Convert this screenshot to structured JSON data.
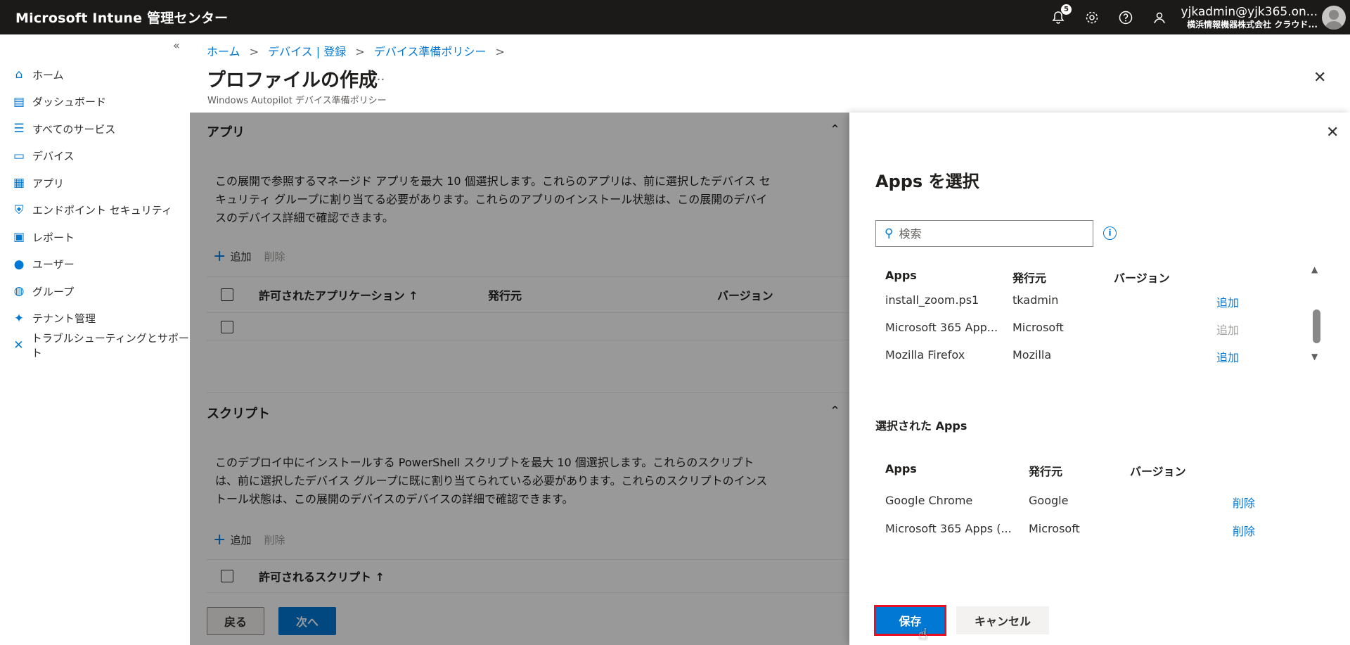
{
  "topbar": {
    "brand": "Microsoft Intune 管理センター",
    "notification_count": "5",
    "icons": [
      "bell-icon",
      "gear-icon",
      "help-icon",
      "feedback-icon"
    ],
    "account_name": "yjkadmin@yjk365.on...",
    "account_org": "横浜情報機器株式会社 クラウド..."
  },
  "sidebar": {
    "collapse_glyph": "«",
    "items": [
      {
        "label": "ホーム",
        "icon": "home-icon",
        "glyph": "⌂"
      },
      {
        "label": "ダッシュボード",
        "icon": "dashboard-icon",
        "glyph": "▤"
      },
      {
        "label": "すべてのサービス",
        "icon": "list-icon",
        "glyph": "☰"
      },
      {
        "label": "デバイス",
        "icon": "device-icon",
        "glyph": "▭"
      },
      {
        "label": "アプリ",
        "icon": "apps-grid-icon",
        "glyph": "▦"
      },
      {
        "label": "エンドポイント セキュリティ",
        "icon": "shield-icon",
        "glyph": "⛨"
      },
      {
        "label": "レポート",
        "icon": "report-icon",
        "glyph": "▣"
      },
      {
        "label": "ユーザー",
        "icon": "user-icon",
        "glyph": "●"
      },
      {
        "label": "グループ",
        "icon": "group-icon",
        "glyph": "◍"
      },
      {
        "label": "テナント管理",
        "icon": "tenant-icon",
        "glyph": "✦"
      },
      {
        "label": "トラブルシューティングとサポート",
        "icon": "wrench-icon",
        "glyph": "✕"
      }
    ]
  },
  "breadcrumb": {
    "items": [
      "ホーム",
      "デバイス | 登録",
      "デバイス準備ポリシー"
    ],
    "sep": ">"
  },
  "page": {
    "title": "プロファイルの作成",
    "more": "...",
    "subtitle": "Windows Autopilot デバイス準備ポリシー",
    "close": "✕"
  },
  "apps_section": {
    "title": "アプリ",
    "description": "この展開で参照するマネージド アプリを最大 10 個選択します。これらのアプリは、前に選択したデバイス セキュリティ グループに割り当てる必要があります。これらのアプリのインストール状態は、この展開のデバイスのデバイス詳細で確認できます。",
    "add": "追加",
    "delete": "削除",
    "columns": [
      "許可されたアプリケーション ↑",
      "発行元",
      "バージョン"
    ]
  },
  "scripts_section": {
    "title": "スクリプト",
    "description": "このデプロイ中にインストールする PowerShell スクリプトを最大 10 個選択します。これらのスクリプトは、前に選択したデバイス グループに既に割り当てられている必要があります。これらのスクリプトのインストール状態は、この展開のデバイスのデバイスの詳細で確認できます。",
    "add": "追加",
    "delete": "削除",
    "columns": [
      "許可されるスクリプト ↑"
    ]
  },
  "footer": {
    "back": "戻る",
    "next": "次へ"
  },
  "panel": {
    "title": "Apps を選択",
    "close": "✕",
    "search_placeholder": "検索",
    "info": "i",
    "columns": [
      "Apps",
      "発行元",
      "バージョン"
    ],
    "rows": [
      {
        "name": "install_zoom.ps1",
        "publisher": "tkadmin",
        "version": "",
        "action": "追加",
        "enabled": true
      },
      {
        "name": "Microsoft 365 App...",
        "publisher": "Microsoft",
        "version": "",
        "action": "追加",
        "enabled": false
      },
      {
        "name": "Mozilla Firefox",
        "publisher": "Mozilla",
        "version": "",
        "action": "追加",
        "enabled": true
      }
    ],
    "selected_title": "選択された Apps",
    "selected_columns": [
      "Apps",
      "発行元",
      "バージョン"
    ],
    "selected_rows": [
      {
        "name": "Google Chrome",
        "publisher": "Google",
        "version": "",
        "action": "削除"
      },
      {
        "name": "Microsoft 365 Apps (...",
        "publisher": "Microsoft",
        "version": "",
        "action": "削除"
      }
    ],
    "save": "保存",
    "cancel": "キャンセル"
  },
  "colors": {
    "accent": "#0078d4",
    "topbar": "#1b1a19",
    "highlight_border": "#e81123"
  }
}
